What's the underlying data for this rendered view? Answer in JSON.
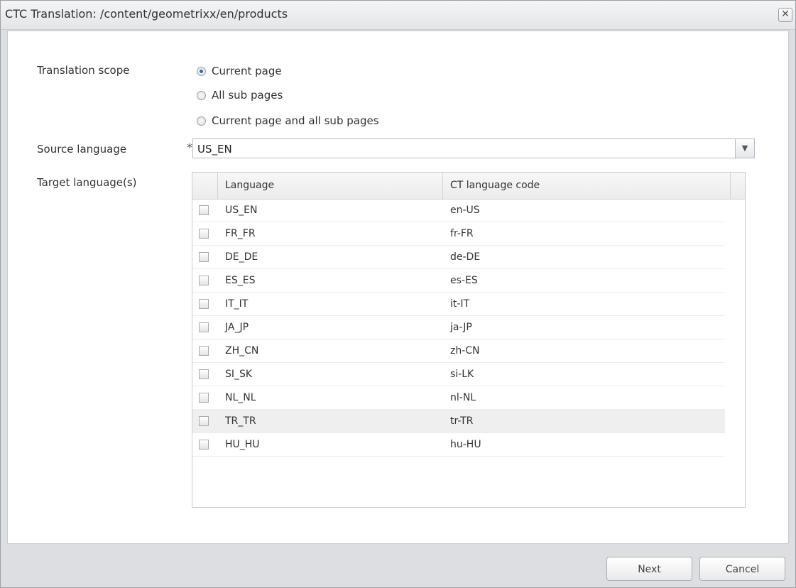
{
  "dialog": {
    "title": "CTC Translation: /content/geometrixx/en/products",
    "close_glyph": "✕"
  },
  "form": {
    "scope_label": "Translation scope",
    "scope_options": [
      {
        "label": "Current page",
        "selected": true
      },
      {
        "label": "All sub pages",
        "selected": false
      },
      {
        "label": "Current page and all sub pages",
        "selected": false
      }
    ],
    "source_label": "Source language",
    "required_marker": "*",
    "source_value": "US_EN",
    "target_label": "Target language(s)"
  },
  "grid": {
    "columns": [
      "Language",
      "CT language code"
    ],
    "rows": [
      {
        "language": "US_EN",
        "code": "en-US",
        "checked": false
      },
      {
        "language": "FR_FR",
        "code": "fr-FR",
        "checked": false
      },
      {
        "language": "DE_DE",
        "code": "de-DE",
        "checked": false
      },
      {
        "language": "ES_ES",
        "code": "es-ES",
        "checked": false
      },
      {
        "language": "IT_IT",
        "code": "it-IT",
        "checked": false
      },
      {
        "language": "JA_JP",
        "code": "ja-JP",
        "checked": false
      },
      {
        "language": "ZH_CN",
        "code": "zh-CN",
        "checked": false
      },
      {
        "language": "SI_SK",
        "code": "si-LK",
        "checked": false
      },
      {
        "language": "NL_NL",
        "code": "nl-NL",
        "checked": false
      },
      {
        "language": "TR_TR",
        "code": "tr-TR",
        "checked": false,
        "highlighted": true
      },
      {
        "language": "HU_HU",
        "code": "hu-HU",
        "checked": false
      }
    ]
  },
  "footer": {
    "next_label": "Next",
    "cancel_label": "Cancel"
  }
}
